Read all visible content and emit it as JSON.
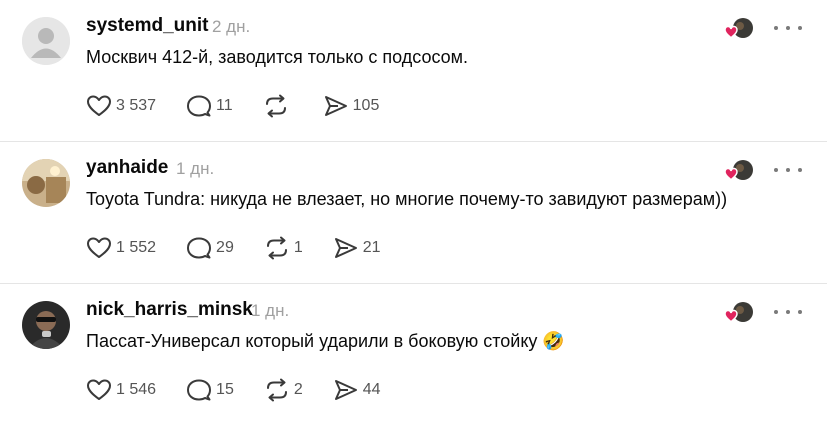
{
  "posts": [
    {
      "username": "systemd_unit",
      "time": "2 дн.",
      "text": "Москвич 412-й, заводится только с подсосом.",
      "likes": "3 537",
      "replies": "11",
      "reposts": "",
      "shares": "105",
      "avatar": "default-avatar"
    },
    {
      "username": "yanhaide",
      "time": "1 дн.",
      "text": "Toyota Tundra: никуда не влезает, но многие почему-то завидуют размерам))",
      "likes": "1 552",
      "replies": "29",
      "reposts": "1",
      "shares": "21",
      "avatar": "photo-avatar"
    },
    {
      "username": "nick_harris_minsk",
      "time": "1 дн.",
      "text": "Пассат-Универсал который ударили в боковую стойку 🤣",
      "likes": "1 546",
      "replies": "15",
      "reposts": "2",
      "shares": "44",
      "avatar": "photo-avatar"
    }
  ],
  "colors": {
    "text": "#0a0a0a",
    "muted": "#a0a0a0",
    "count": "#555555",
    "icon": "#3a3a3a",
    "divider": "#e5e5e5",
    "heart_badge": "#e0245e"
  }
}
